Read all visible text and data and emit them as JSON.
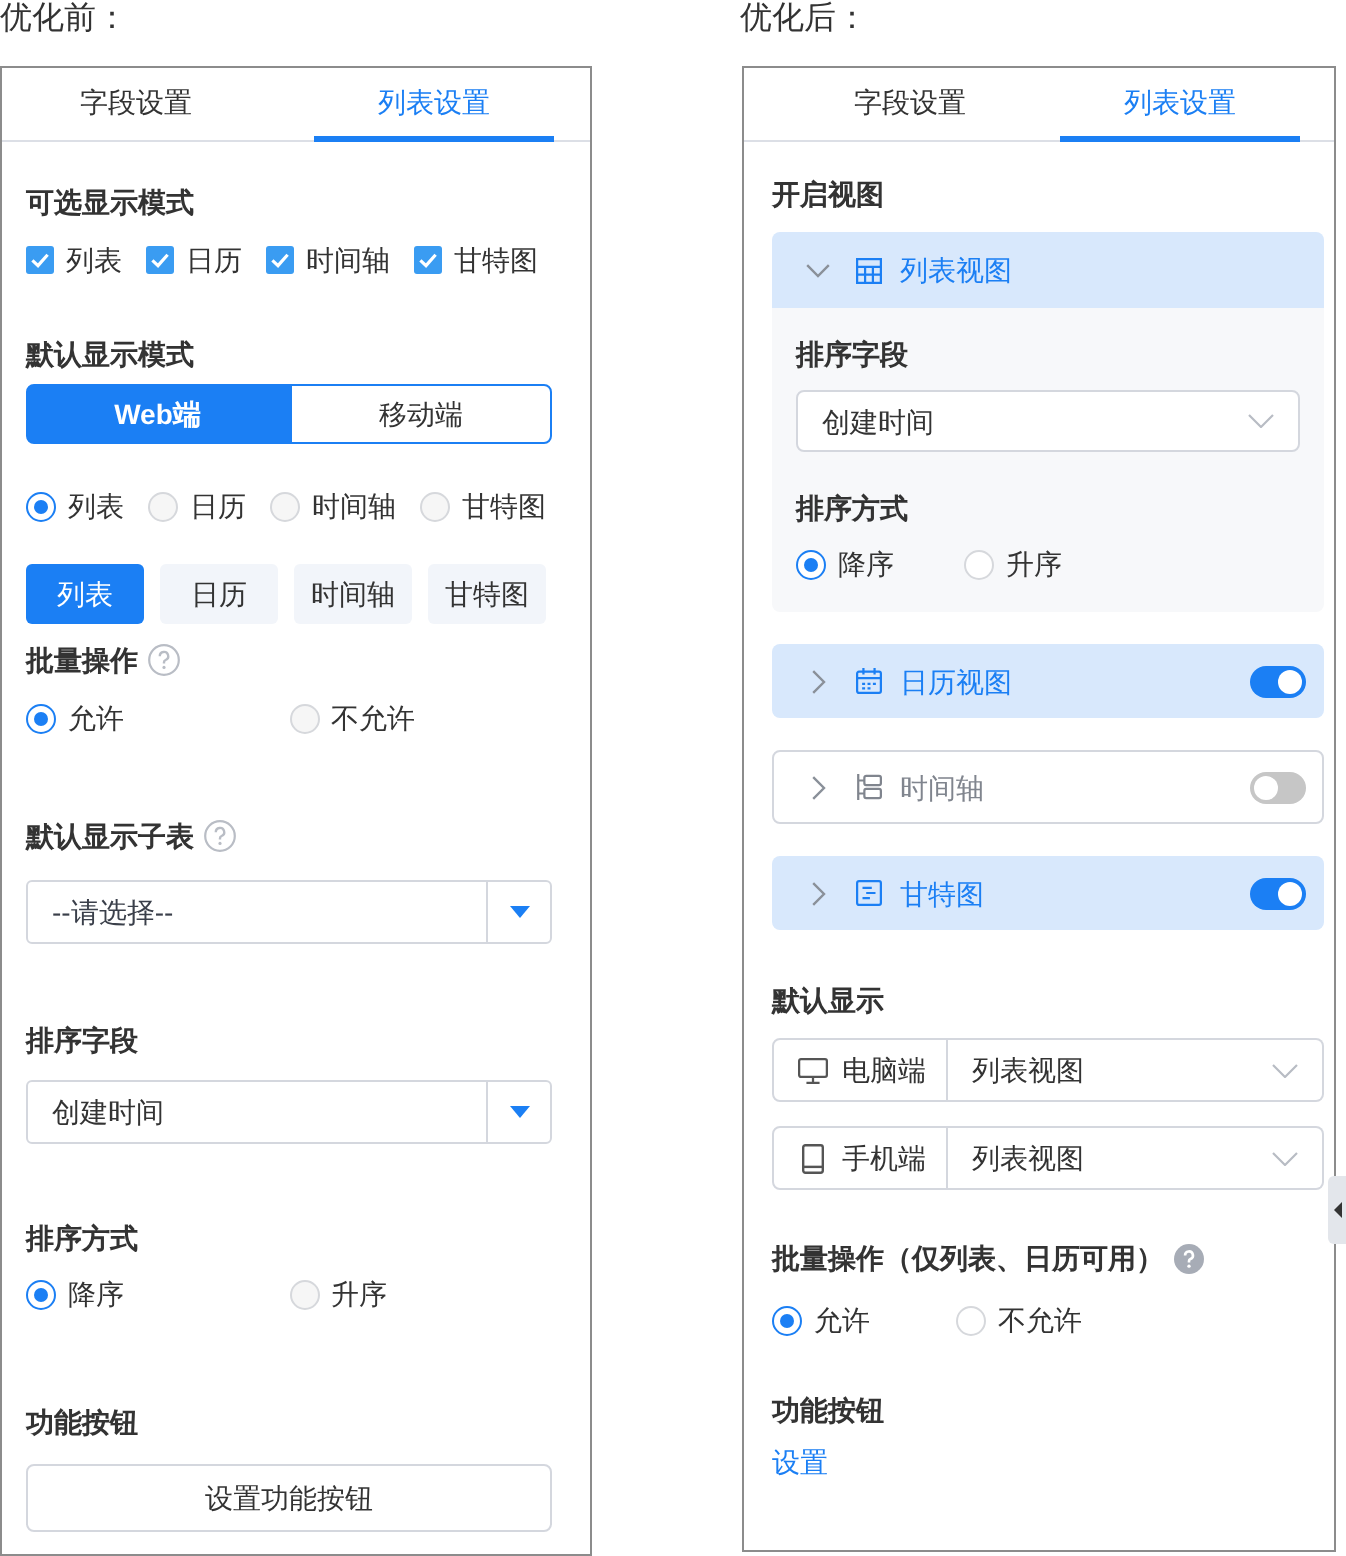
{
  "before": {
    "caption": "优化前：",
    "tabs": [
      {
        "label": "字段设置",
        "selected": false
      },
      {
        "label": "列表设置",
        "selected": true
      }
    ],
    "selectable_modes": {
      "label": "可选显示模式",
      "options": [
        {
          "label": "列表",
          "checked": true
        },
        {
          "label": "日历",
          "checked": true
        },
        {
          "label": "时间轴",
          "checked": true
        },
        {
          "label": "甘特图",
          "checked": true
        }
      ]
    },
    "default_mode": {
      "label": "默认显示模式",
      "platforms": [
        {
          "label": "Web端",
          "selected": true
        },
        {
          "label": "移动端",
          "selected": false
        }
      ],
      "radios": [
        {
          "label": "列表",
          "selected": true
        },
        {
          "label": "日历",
          "selected": false
        },
        {
          "label": "时间轴",
          "selected": false
        },
        {
          "label": "甘特图",
          "selected": false
        }
      ],
      "buttons": [
        {
          "label": "列表",
          "selected": true
        },
        {
          "label": "日历",
          "selected": false
        },
        {
          "label": "时间轴",
          "selected": false
        },
        {
          "label": "甘特图",
          "selected": false
        }
      ]
    },
    "batch_operation": {
      "label": "批量操作",
      "options": [
        {
          "label": "允许",
          "selected": true
        },
        {
          "label": "不允许",
          "selected": false
        }
      ]
    },
    "default_subtable": {
      "label": "默认显示子表",
      "placeholder": "--请选择--"
    },
    "sort_field": {
      "label": "排序字段",
      "value": "创建时间"
    },
    "sort_order": {
      "label": "排序方式",
      "options": [
        {
          "label": "降序",
          "selected": true
        },
        {
          "label": "升序",
          "selected": false
        }
      ]
    },
    "function_buttons": {
      "label": "功能按钮",
      "button": "设置功能按钮"
    }
  },
  "after": {
    "caption": "优化后：",
    "tabs": [
      {
        "label": "字段设置",
        "selected": false
      },
      {
        "label": "列表设置",
        "selected": true
      }
    ],
    "views": {
      "label": "开启视图",
      "items": [
        {
          "label": "列表视图",
          "expanded": true,
          "sort_field": {
            "label": "排序字段",
            "value": "创建时间"
          },
          "sort_order": {
            "label": "排序方式",
            "options": [
              {
                "label": "降序",
                "selected": true
              },
              {
                "label": "升序",
                "selected": false
              }
            ]
          }
        },
        {
          "label": "日历视图",
          "expanded": false,
          "on": true
        },
        {
          "label": "时间轴",
          "expanded": false,
          "on": false
        },
        {
          "label": "甘特图",
          "expanded": false,
          "on": true
        }
      ]
    },
    "default_display": {
      "label": "默认显示",
      "devices": [
        {
          "label": "电脑端",
          "value": "列表视图"
        },
        {
          "label": "手机端",
          "value": "列表视图"
        }
      ]
    },
    "batch_operation": {
      "label": "批量操作（仅列表、日历可用）",
      "options": [
        {
          "label": "允许",
          "selected": true
        },
        {
          "label": "不允许",
          "selected": false
        }
      ]
    },
    "function_buttons": {
      "label": "功能按钮",
      "link": "设置"
    }
  }
}
